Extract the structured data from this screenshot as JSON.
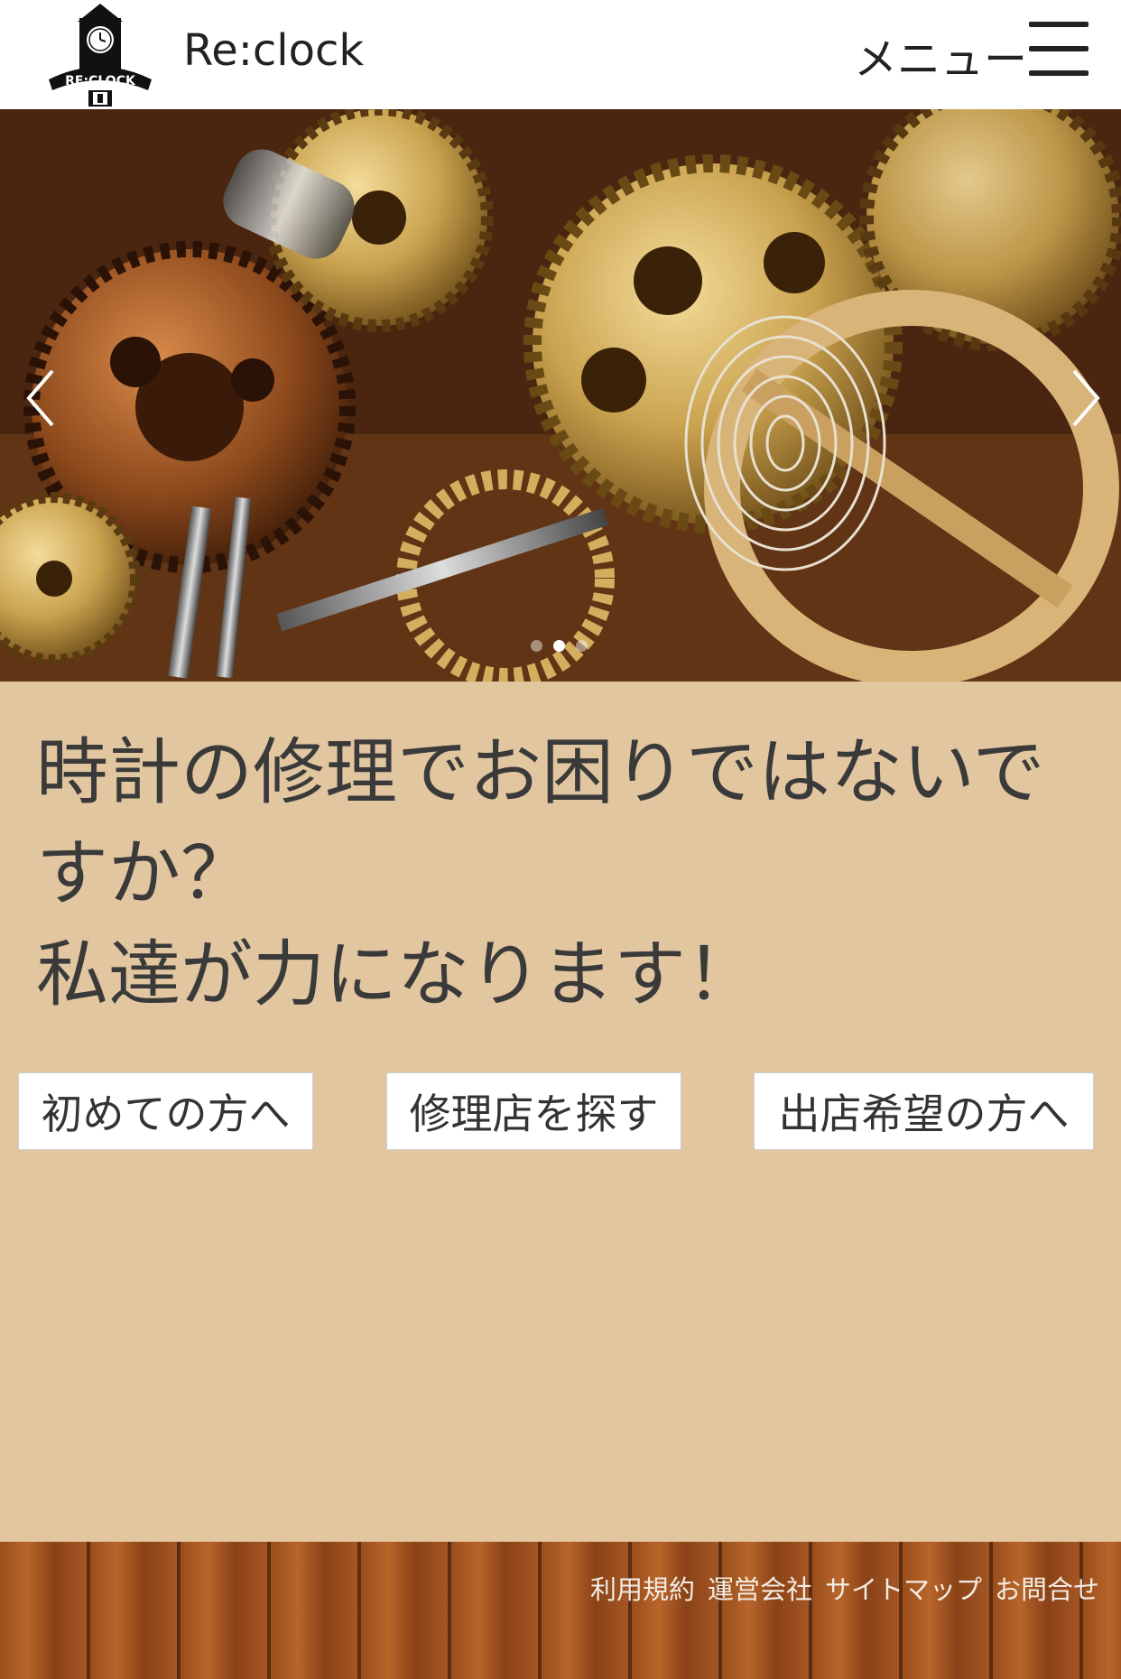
{
  "header": {
    "logo_text": "RE:CLOCK",
    "site_title": "Re:clock",
    "menu_label": "メニュー"
  },
  "hero": {
    "slide_count": 3,
    "active_slide": 2
  },
  "main": {
    "headline_lines": [
      "時計の修理でお困りではないで",
      "すか？",
      "私達が力になります！"
    ],
    "buttons": [
      "初めての方へ",
      "修理店を探す",
      "出店希望の方へ"
    ]
  },
  "footer": {
    "links": [
      "利用規約",
      "運営会社",
      "サイトマップ",
      "お問合せ"
    ]
  },
  "colors": {
    "background": "#e2c6a0",
    "header": "#ffffff",
    "text": "#3a3a3a"
  }
}
